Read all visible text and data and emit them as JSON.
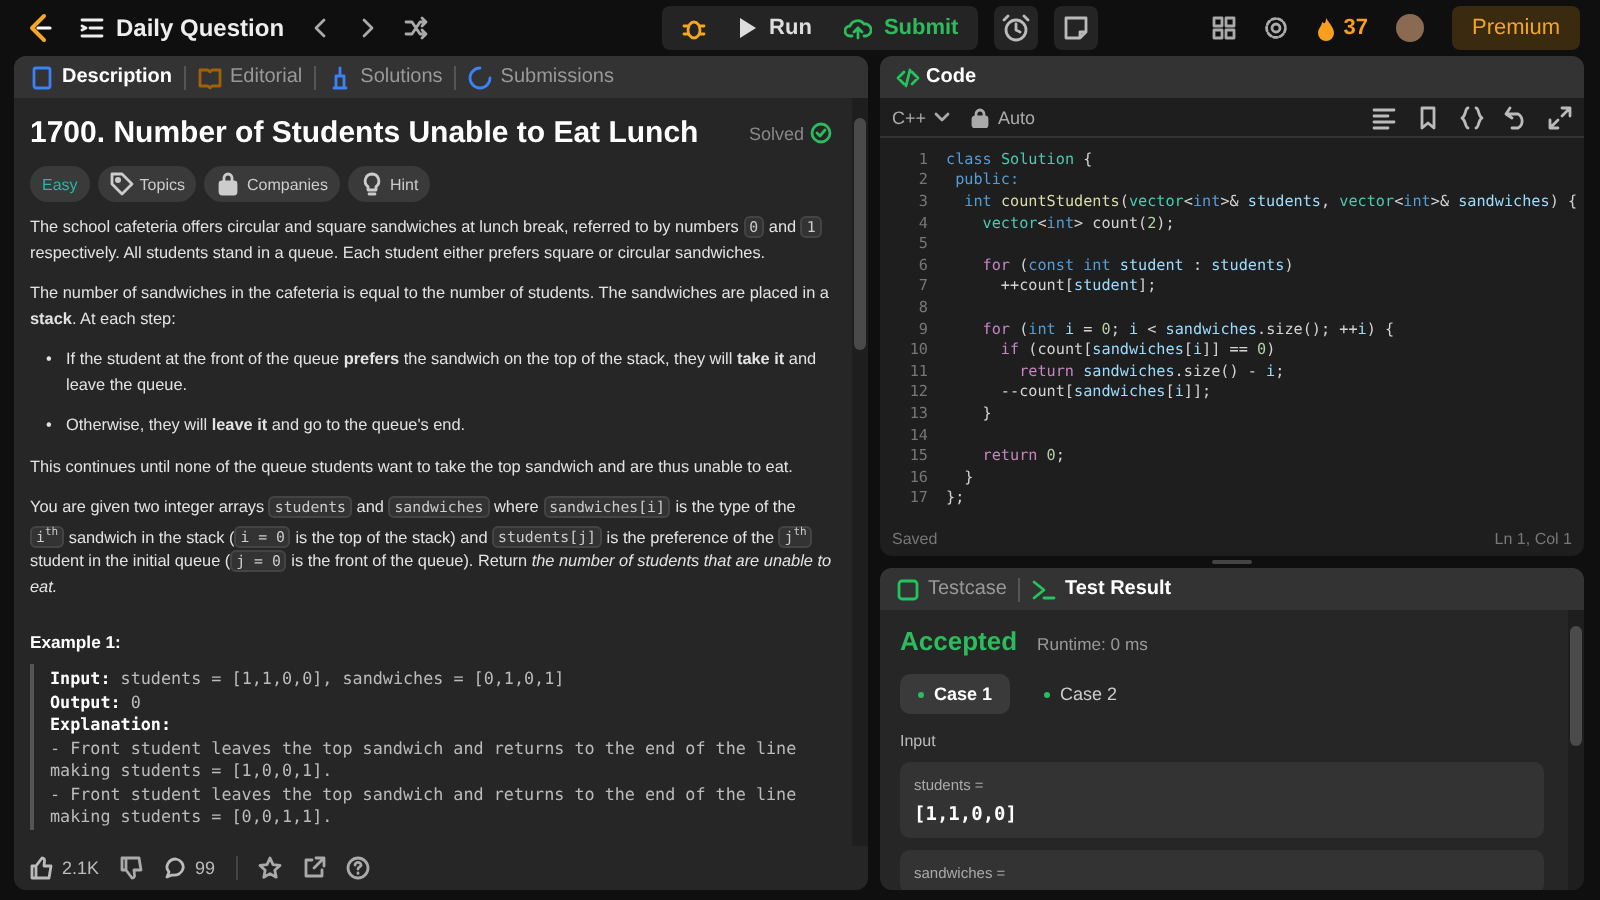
{
  "top_bar": {
    "title": "Daily Question",
    "run": "Run",
    "submit": "Submit",
    "streak": "37",
    "premium": "Premium"
  },
  "description_panel": {
    "tabs": [
      {
        "label": "Description",
        "selected": true
      },
      {
        "label": "Editorial",
        "selected": false
      },
      {
        "label": "Solutions",
        "selected": false
      },
      {
        "label": "Submissions",
        "selected": false
      }
    ],
    "title": "1700. Number of Students Unable to Eat Lunch",
    "status": "Solved",
    "difficulty": "Easy",
    "chips": [
      {
        "kind": "topics",
        "label": "Topics"
      },
      {
        "kind": "companies",
        "label": "Companies"
      },
      {
        "kind": "hint",
        "label": "Hint"
      }
    ],
    "blocks": [
      {
        "kind": "para",
        "parts": [
          {
            "kind": "text",
            "text": "The school cafeteria offers circular and square sandwiches at lunch break, referred to by numbers "
          },
          {
            "kind": "code",
            "text": "0"
          },
          {
            "kind": "text",
            "text": " and "
          },
          {
            "kind": "code",
            "text": "1"
          },
          {
            "kind": "text",
            "text": " respectively. All students stand in a queue. Each student either prefers square or circular sandwiches."
          }
        ]
      },
      {
        "kind": "para",
        "parts": [
          {
            "kind": "text",
            "text": "The number of sandwiches in the cafeteria is equal to the number of students. The sandwiches are placed in a **stack**. At each step:"
          }
        ]
      },
      {
        "kind": "bullet",
        "marker": "•",
        "parts": [
          {
            "kind": "text",
            "text": "If the student at the front of the queue **prefers** the sandwich on the top of the stack, they will **take it** and leave the queue."
          }
        ]
      },
      {
        "kind": "bullet",
        "marker": "•",
        "parts": [
          {
            "kind": "text",
            "text": "Otherwise, they will **leave it** and go to the queue's end."
          }
        ]
      },
      {
        "kind": "para",
        "parts": [
          {
            "kind": "text",
            "text": "This continues until none of the queue students want to take the top sandwich and are thus unable to eat."
          }
        ]
      },
      {
        "kind": "para",
        "parts": [
          {
            "kind": "text",
            "text": "You are given two integer arrays "
          },
          {
            "kind": "code",
            "text": "students"
          },
          {
            "kind": "text",
            "text": " and "
          },
          {
            "kind": "code",
            "text": "sandwiches"
          },
          {
            "kind": "text",
            "text": " where "
          },
          {
            "kind": "code",
            "text": "sandwiches[i]"
          },
          {
            "kind": "text",
            "text": " is the type of the "
          },
          {
            "kind": "code",
            "text": "i$^{th}$"
          },
          {
            "kind": "text",
            "text": " sandwich in the stack ("
          },
          {
            "kind": "code",
            "text": "i = 0"
          },
          {
            "kind": "text",
            "text": " is the top of the stack) and "
          },
          {
            "kind": "code",
            "text": "students[j]"
          },
          {
            "kind": "text",
            "text": " is the preference of the "
          },
          {
            "kind": "code",
            "text": "j$^{th}$"
          },
          {
            "kind": "text",
            "text": " student in the initial queue ("
          },
          {
            "kind": "code",
            "text": "j = 0"
          },
          {
            "kind": "text",
            "text": " is the front of the queue). Return *the number of students that are unable to eat.*"
          }
        ]
      }
    ],
    "example": {
      "title": "Example 1:",
      "lines": [
        "**Input:** students = [1,1,0,0], sandwiches = [0,1,0,1]",
        "**Output:** 0",
        "**Explanation:**",
        "- Front student leaves the top sandwich and returns to the end of the line",
        "making students = [1,0,0,1].",
        "- Front student leaves the top sandwich and returns to the end of the line",
        "making students = [0,0,1,1]."
      ]
    },
    "footer": {
      "likes": "2.1K",
      "comments": "99"
    }
  },
  "code_panel": {
    "title": "Code",
    "language": "C++",
    "mode": "Auto",
    "lines": [
      {
        "number": "1",
        "tokens": [
          {
            "kind": "kw",
            "text": "class "
          },
          {
            "kind": "ty",
            "text": "Solution"
          },
          {
            "kind": "p",
            "text": " {"
          }
        ]
      },
      {
        "number": "2",
        "tokens": [
          {
            "kind": "kw",
            "text": " public:"
          }
        ]
      },
      {
        "number": "3",
        "tokens": [
          {
            "kind": "kw",
            "text": "  int "
          },
          {
            "kind": "f",
            "text": "countStudents"
          },
          {
            "kind": "p",
            "text": "("
          },
          {
            "kind": "ty",
            "text": "vector"
          },
          {
            "kind": "p",
            "text": "<"
          },
          {
            "kind": "kw",
            "text": "int"
          },
          {
            "kind": "p",
            "text": ">& "
          },
          {
            "kind": "id",
            "text": "students"
          },
          {
            "kind": "p",
            "text": ", "
          },
          {
            "kind": "ty",
            "text": "vector"
          },
          {
            "kind": "p",
            "text": "<"
          },
          {
            "kind": "kw",
            "text": "int"
          },
          {
            "kind": "p",
            "text": ">& "
          },
          {
            "kind": "id",
            "text": "sandwiches"
          },
          {
            "kind": "p",
            "text": ") {"
          }
        ]
      },
      {
        "number": "4",
        "tokens": [
          {
            "kind": "ty",
            "text": "    vector"
          },
          {
            "kind": "p",
            "text": "<"
          },
          {
            "kind": "kw",
            "text": "int"
          },
          {
            "kind": "p",
            "text": "> count("
          },
          {
            "kind": "num",
            "text": "2"
          },
          {
            "kind": "p",
            "text": ");"
          }
        ]
      },
      {
        "number": "5"
      },
      {
        "number": "6",
        "tokens": [
          {
            "kind": "ctl",
            "text": "    for "
          },
          {
            "kind": "p",
            "text": "("
          },
          {
            "kind": "kw",
            "text": "const int "
          },
          {
            "kind": "id",
            "text": "student"
          },
          {
            "kind": "p",
            "text": " : "
          },
          {
            "kind": "id",
            "text": "students"
          },
          {
            "kind": "p",
            "text": ")"
          }
        ]
      },
      {
        "number": "7",
        "tokens": [
          {
            "kind": "p",
            "text": "      ++count["
          },
          {
            "kind": "id",
            "text": "student"
          },
          {
            "kind": "p",
            "text": "];"
          }
        ]
      },
      {
        "number": "8"
      },
      {
        "number": "9",
        "tokens": [
          {
            "kind": "ctl",
            "text": "    for "
          },
          {
            "kind": "p",
            "text": "("
          },
          {
            "kind": "kw",
            "text": "int "
          },
          {
            "kind": "id",
            "text": "i"
          },
          {
            "kind": "p",
            "text": " = "
          },
          {
            "kind": "num",
            "text": "0"
          },
          {
            "kind": "p",
            "text": "; "
          },
          {
            "kind": "id",
            "text": "i"
          },
          {
            "kind": "p",
            "text": " < "
          },
          {
            "kind": "id",
            "text": "sandwiches"
          },
          {
            "kind": "p",
            "text": ".size(); ++"
          },
          {
            "kind": "id",
            "text": "i"
          },
          {
            "kind": "p",
            "text": ") {"
          }
        ]
      },
      {
        "number": "10",
        "tokens": [
          {
            "kind": "ctl",
            "text": "      if "
          },
          {
            "kind": "p",
            "text": "(count["
          },
          {
            "kind": "id",
            "text": "sandwiches"
          },
          {
            "kind": "p",
            "text": "["
          },
          {
            "kind": "id",
            "text": "i"
          },
          {
            "kind": "p",
            "text": "]] == "
          },
          {
            "kind": "num",
            "text": "0"
          },
          {
            "kind": "p",
            "text": ")"
          }
        ]
      },
      {
        "number": "11",
        "tokens": [
          {
            "kind": "ctl",
            "text": "        return "
          },
          {
            "kind": "id",
            "text": "sandwiches"
          },
          {
            "kind": "p",
            "text": ".size() - "
          },
          {
            "kind": "id",
            "text": "i"
          },
          {
            "kind": "p",
            "text": ";"
          }
        ]
      },
      {
        "number": "12",
        "tokens": [
          {
            "kind": "p",
            "text": "      --count["
          },
          {
            "kind": "id",
            "text": "sandwiches"
          },
          {
            "kind": "p",
            "text": "["
          },
          {
            "kind": "id",
            "text": "i"
          },
          {
            "kind": "p",
            "text": "]];"
          }
        ]
      },
      {
        "number": "13",
        "tokens": [
          {
            "kind": "p",
            "text": "    }"
          }
        ]
      },
      {
        "number": "14"
      },
      {
        "number": "15",
        "tokens": [
          {
            "kind": "ctl",
            "text": "    return "
          },
          {
            "kind": "num",
            "text": "0"
          },
          {
            "kind": "p",
            "text": ";"
          }
        ]
      },
      {
        "number": "16",
        "tokens": [
          {
            "kind": "p",
            "text": "  }"
          }
        ]
      },
      {
        "number": "17",
        "tokens": [
          {
            "kind": "p",
            "text": "};"
          }
        ]
      }
    ],
    "save_status": "Saved",
    "cursor": "Ln 1, Col 1"
  },
  "test_panel": {
    "tabs": [
      {
        "label": "Testcase",
        "selected": false
      },
      {
        "label": "Test Result",
        "selected": true
      }
    ],
    "verdict": "Accepted",
    "runtime": "Runtime: 0 ms",
    "cases": [
      {
        "label": "Case 1",
        "selected": true,
        "passed": true
      },
      {
        "label": "Case 2",
        "selected": false,
        "passed": true
      }
    ],
    "input_label": "Input",
    "inputs": [
      {
        "name": "students =",
        "value": "[1,1,0,0]"
      },
      {
        "name": "sandwiches ="
      }
    ]
  }
}
